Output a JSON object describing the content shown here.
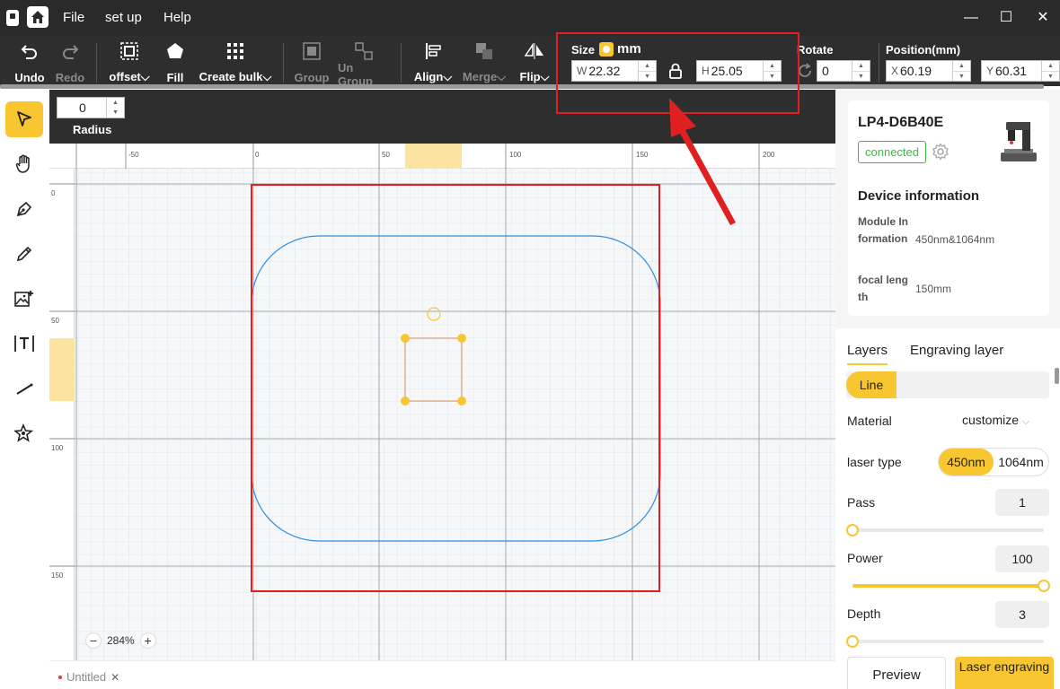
{
  "menu": {
    "file": "File",
    "setup": "set up",
    "help": "Help"
  },
  "toolbar": {
    "undo": "Undo",
    "redo": "Redo",
    "offset": "offset",
    "fill": "Fill",
    "create_bulk": "Create bulk",
    "group": "Group",
    "ungroup": "Un Group",
    "align": "Align",
    "merge": "Merge",
    "flip": "Flip",
    "size_label": "Size",
    "unit": "mm",
    "w_prefix": "W",
    "w_value": "22.32",
    "h_prefix": "H",
    "h_value": "25.05",
    "rotate_label": "Rotate",
    "rotate_value": "0",
    "position_label": "Position(mm)",
    "x_prefix": "X",
    "x_value": "60.19",
    "y_prefix": "Y",
    "y_value": "60.31"
  },
  "props": {
    "radius_value": "0",
    "radius_label": "Radius"
  },
  "ruler": {
    "top": [
      "-50",
      "0",
      "50",
      "100",
      "150",
      "200"
    ],
    "left": [
      "0",
      "50",
      "100",
      "150"
    ]
  },
  "zoom": {
    "value": "284%"
  },
  "document": {
    "tab": "Untitled"
  },
  "device": {
    "name": "LP4-D6B40E",
    "status": "connected",
    "info_title": "Device information",
    "module_key": "Module Information",
    "module_val": "450nm&1064nm",
    "focal_key": "focal length",
    "focal_val": "150mm"
  },
  "layers": {
    "tab_layers": "Layers",
    "tab_engraving": "Engraving layer",
    "chip": "Line",
    "material_label": "Material",
    "material_value": "customize",
    "laser_type_label": "laser type",
    "laser_450": "450nm",
    "laser_1064": "1064nm",
    "pass_label": "Pass",
    "pass_value": "1",
    "power_label": "Power",
    "power_value": "100",
    "depth_label": "Depth",
    "depth_value": "3",
    "pass_fraction": 0,
    "power_fraction": 1,
    "depth_fraction": 0
  },
  "actions": {
    "preview": "Preview",
    "engrave": "Laser engraving"
  },
  "colors": {
    "accent": "#f7c631",
    "toolbar": "#2e2e2e",
    "annotation": "#e02020",
    "shape_stroke": "#2f8fe0",
    "connected": "#3cb84a"
  }
}
